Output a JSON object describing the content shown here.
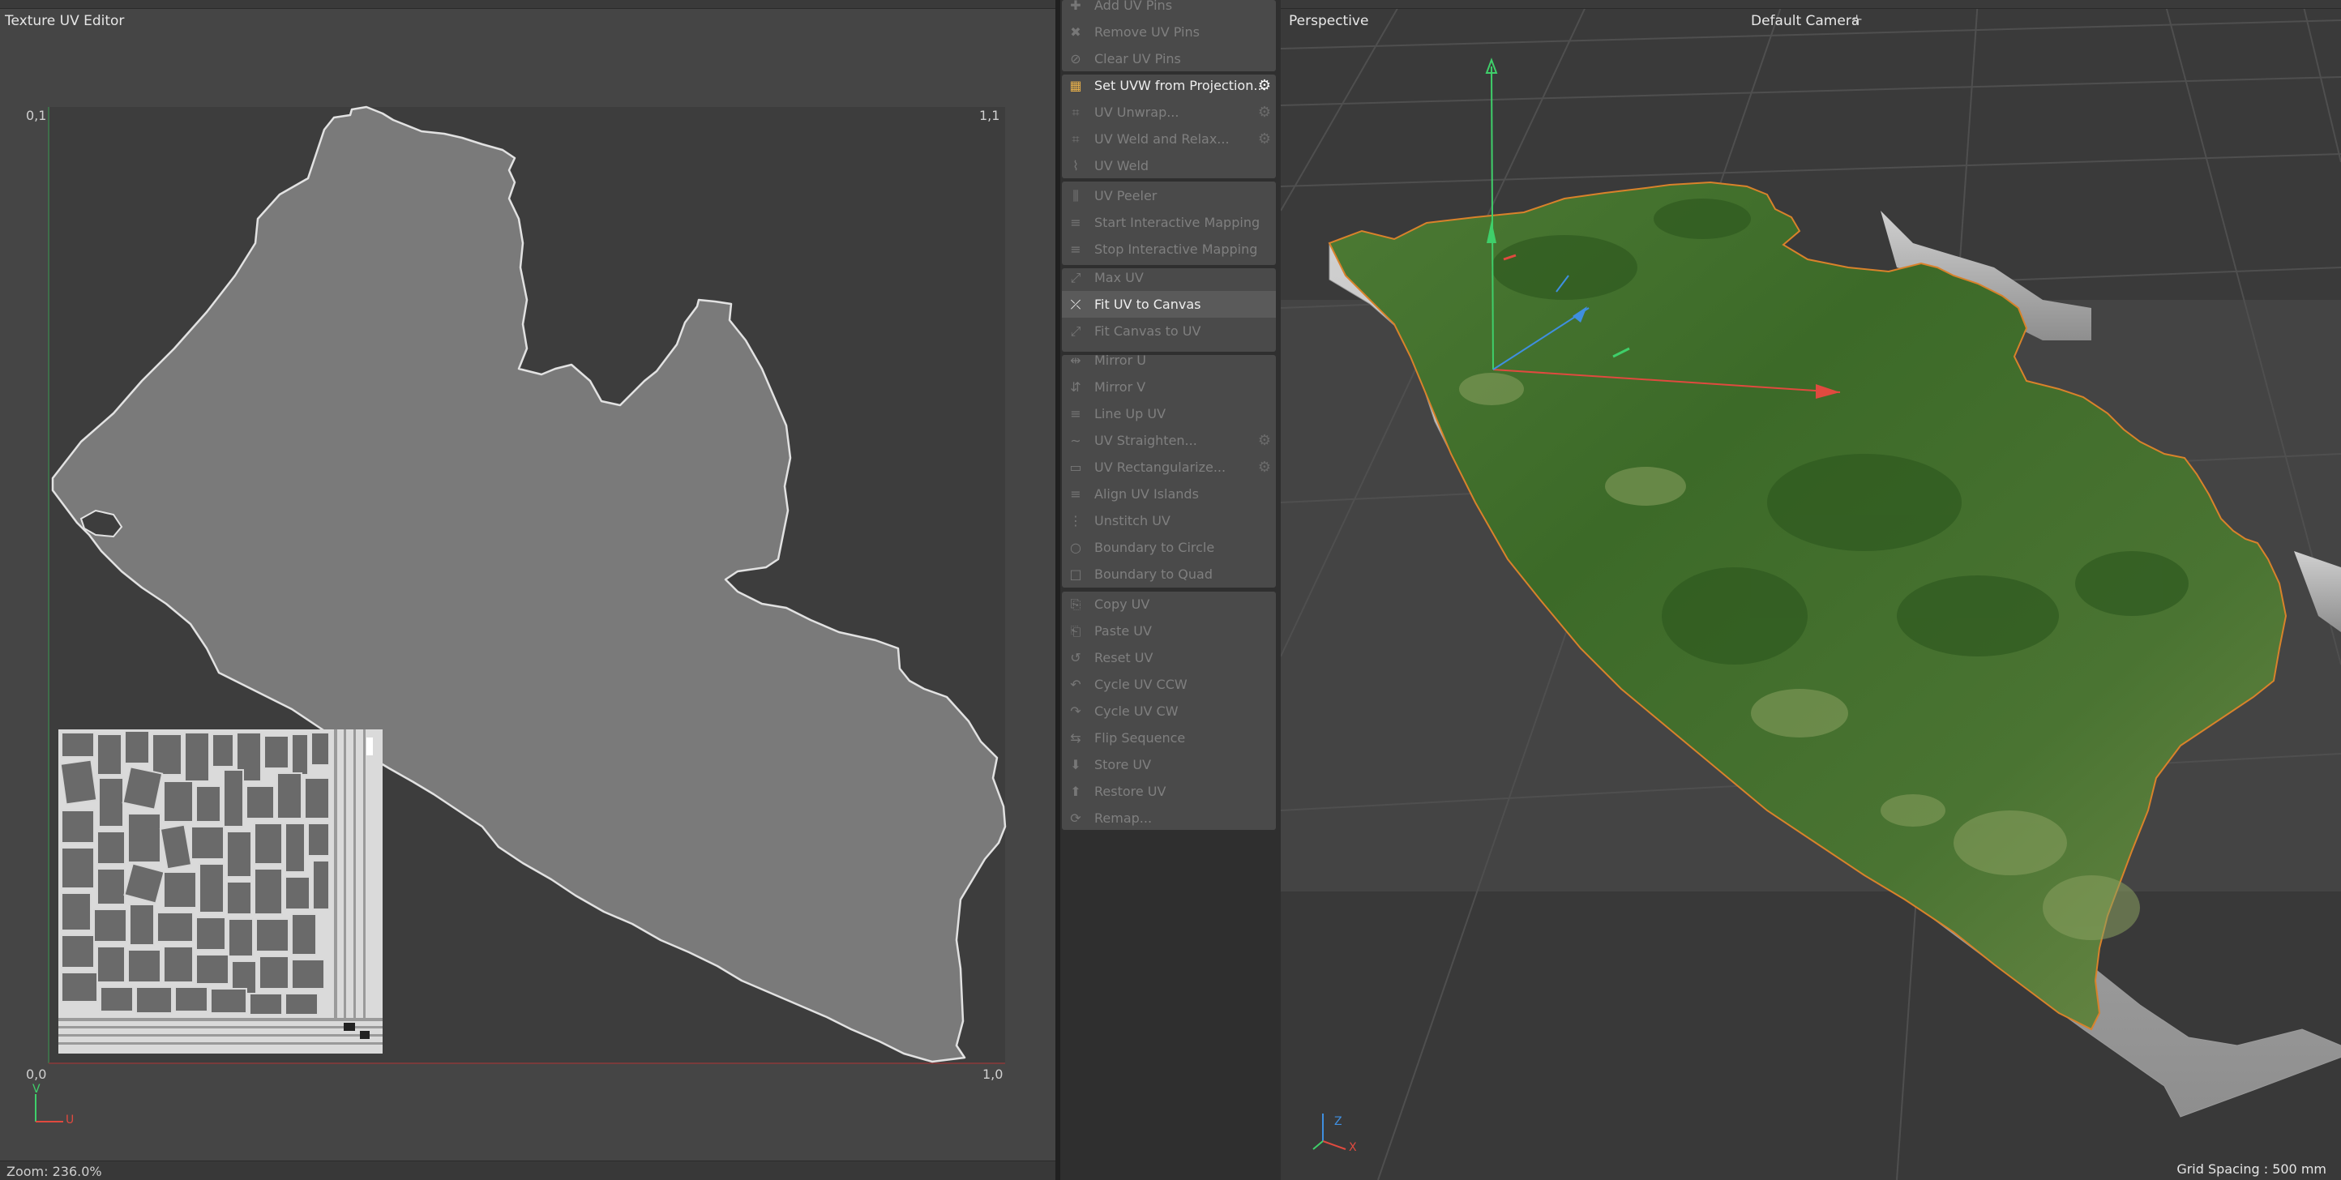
{
  "uv_editor": {
    "title": "Texture UV Editor",
    "corners": {
      "top_left": "0,1",
      "top_right": "1,1",
      "bottom_left": "0,0",
      "bottom_right": "1,0"
    },
    "axis": {
      "v": "V",
      "u": "U"
    },
    "zoom": "Zoom: 236.0%"
  },
  "commands": [
    {
      "label": "Add UV Pins",
      "enabled": false,
      "gear": false
    },
    {
      "label": "Remove UV Pins",
      "enabled": false,
      "gear": false
    },
    {
      "label": "Clear UV Pins",
      "enabled": false,
      "gear": false
    },
    {
      "label": "Set UVW from Projection...",
      "enabled": true,
      "gear": true
    },
    {
      "label": "UV Unwrap...",
      "enabled": false,
      "gear": true
    },
    {
      "label": "UV Weld and Relax...",
      "enabled": false,
      "gear": true
    },
    {
      "label": "UV Weld",
      "enabled": false,
      "gear": false
    },
    {
      "label": "UV Peeler",
      "enabled": false,
      "gear": false
    },
    {
      "label": "Start Interactive Mapping",
      "enabled": false,
      "gear": false
    },
    {
      "label": "Stop Interactive Mapping",
      "enabled": false,
      "gear": false
    },
    {
      "label": "Max UV",
      "enabled": false,
      "gear": false
    },
    {
      "label": "Fit UV to Canvas",
      "enabled": true,
      "gear": false
    },
    {
      "label": "Fit Canvas to UV",
      "enabled": false,
      "gear": false
    },
    {
      "label": "Mirror U",
      "enabled": false,
      "gear": false
    },
    {
      "label": "Mirror V",
      "enabled": false,
      "gear": false
    },
    {
      "label": "Line Up UV",
      "enabled": false,
      "gear": false
    },
    {
      "label": "UV Straighten...",
      "enabled": false,
      "gear": true
    },
    {
      "label": "UV Rectangularize...",
      "enabled": false,
      "gear": true
    },
    {
      "label": "Align UV Islands",
      "enabled": false,
      "gear": false
    },
    {
      "label": "Unstitch UV",
      "enabled": false,
      "gear": false
    },
    {
      "label": "Boundary to Circle",
      "enabled": false,
      "gear": false
    },
    {
      "label": "Boundary to Quad",
      "enabled": false,
      "gear": false
    },
    {
      "label": "Copy UV",
      "enabled": false,
      "gear": false
    },
    {
      "label": "Paste UV",
      "enabled": false,
      "gear": false
    },
    {
      "label": "Reset UV",
      "enabled": false,
      "gear": false
    },
    {
      "label": "Cycle UV CCW",
      "enabled": false,
      "gear": false
    },
    {
      "label": "Cycle UV CW",
      "enabled": false,
      "gear": false
    },
    {
      "label": "Flip Sequence",
      "enabled": false,
      "gear": false
    },
    {
      "label": "Store UV",
      "enabled": false,
      "gear": false
    },
    {
      "label": "Restore UV",
      "enabled": false,
      "gear": false
    },
    {
      "label": "Remap...",
      "enabled": false,
      "gear": false
    }
  ],
  "viewport": {
    "view_name": "Perspective",
    "camera": "Default Camera",
    "grid_spacing": "Grid Spacing : 500 mm",
    "axis": {
      "z": "Z",
      "x": "X"
    }
  },
  "colors": {
    "axis_x": "#e04a3f",
    "axis_y": "#3fcf6a",
    "axis_z": "#3f8fe0",
    "terrain": "#3f6b2a"
  }
}
